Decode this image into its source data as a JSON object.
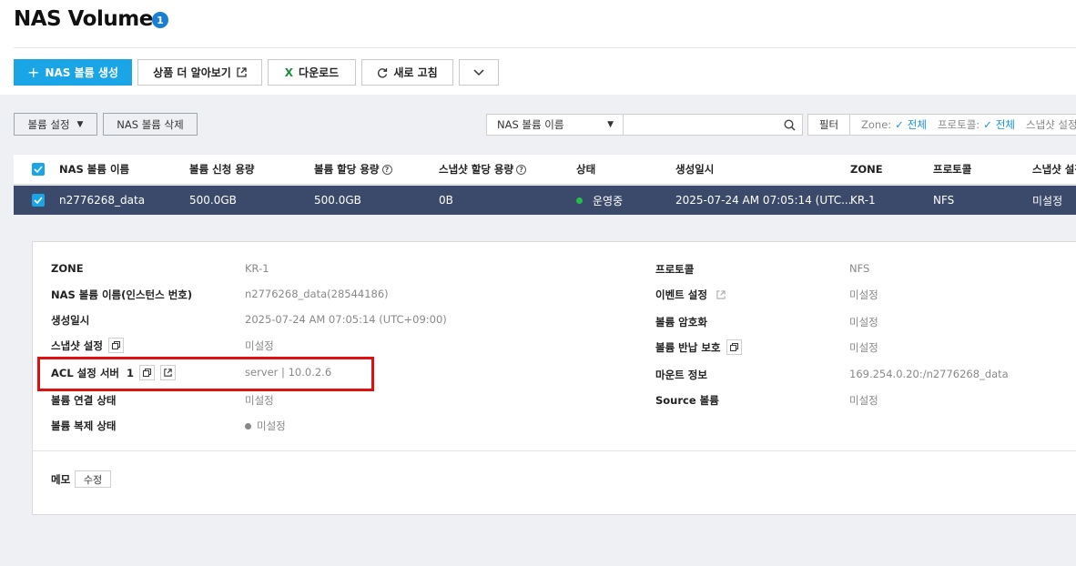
{
  "page": {
    "title": "NAS Volume",
    "badge": "1"
  },
  "toolbar": {
    "create_label": "NAS 볼륨 생성",
    "learn_more_label": "상품 더 알아보기",
    "download_label": "다운로드",
    "refresh_label": "새로 고침"
  },
  "actions": {
    "volume_settings_label": "볼륨 설정",
    "delete_label": "NAS 볼륨 삭제"
  },
  "search": {
    "select_value": "NAS 볼륨 이름",
    "input_value": "",
    "placeholder": ""
  },
  "filter": {
    "button_label": "필터",
    "zone_label": "Zone:",
    "zone_value": "전체",
    "protocol_label": "프로토콜:",
    "protocol_value": "전체",
    "snapshot_label": "스냅샷 설정"
  },
  "table": {
    "headers": [
      "NAS 볼륨 이름",
      "볼륨 신청 용량",
      "볼륨 할당 용량",
      "스냅샷 할당 용량",
      "상태",
      "생성일시",
      "ZONE",
      "프로토콜",
      "스냅샷 설정"
    ],
    "row": {
      "name": "n2776268_data",
      "requested": "500.0GB",
      "allocated": "500.0GB",
      "snapshot_alloc": "0B",
      "status": "운영중",
      "created": "2025-07-24 AM 07:05:14 (UTC...",
      "zone": "KR-1",
      "protocol": "NFS",
      "snapshot": "미설정"
    }
  },
  "details": {
    "left": [
      {
        "label": "ZONE",
        "value": "KR-1"
      },
      {
        "label": "NAS 볼륨 이름(인스턴스 번호)",
        "value": "n2776268_data(28544186)"
      },
      {
        "label": "생성일시",
        "value": "2025-07-24 AM 07:05:14 (UTC+09:00)"
      },
      {
        "label": "스냅샷 설정",
        "value": "미설정"
      },
      {
        "label": "ACL 설정 서버",
        "count": "1",
        "value": "server | 10.0.2.6"
      },
      {
        "label": "볼륨 연결 상태",
        "value": "미설정"
      },
      {
        "label": "볼륨 복제 상태",
        "value": "미설정"
      }
    ],
    "right": [
      {
        "label": "프로토콜",
        "value": "NFS"
      },
      {
        "label": "이벤트 설정",
        "value": "미설정"
      },
      {
        "label": "볼륨 암호화",
        "value": "미설정"
      },
      {
        "label": "볼륨 반납 보호",
        "value": "미설정"
      },
      {
        "label": "마운트 정보",
        "value": "169.254.0.20:/n2776268_data"
      },
      {
        "label": "Source 볼륨",
        "value": "미설정"
      }
    ],
    "memo_label": "메모",
    "memo_edit_label": "수정"
  },
  "colors": {
    "primary": "#1aa5e6",
    "selected_row": "#3b4a6b",
    "status_running": "#21c04b",
    "highlight_box": "#e01010",
    "link_blue": "#1a8fd8"
  }
}
